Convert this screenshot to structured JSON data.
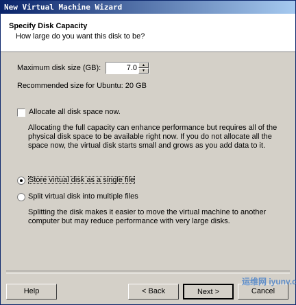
{
  "window": {
    "title": "New Virtual Machine Wizard"
  },
  "header": {
    "title": "Specify Disk Capacity",
    "subtitle": "How large do you want this disk to be?"
  },
  "disk_size": {
    "label": "Maximum disk size (GB):",
    "value": "7.0"
  },
  "recommended": "Recommended size for Ubuntu: 20 GB",
  "allocate": {
    "label": "Allocate all disk space now.",
    "checked": false,
    "description_lines": [
      "Allocating the full capacity can enhance performance but requires all of the",
      "physical disk space to be available right now. If you do not allocate all the",
      "space now, the virtual disk starts small and grows as you add data to it."
    ]
  },
  "storage": {
    "single_label": "Store virtual disk as a single file",
    "multiple_label": "Split virtual disk into multiple files",
    "selected": "single",
    "description_lines": [
      "Splitting the disk makes it easier to move the virtual machine to another",
      "computer but may reduce performance with very large disks."
    ]
  },
  "buttons": {
    "help": "Help",
    "back": "< Back",
    "next": "Next >",
    "cancel": "Cancel"
  },
  "watermark": "运维网 iyunv.com"
}
